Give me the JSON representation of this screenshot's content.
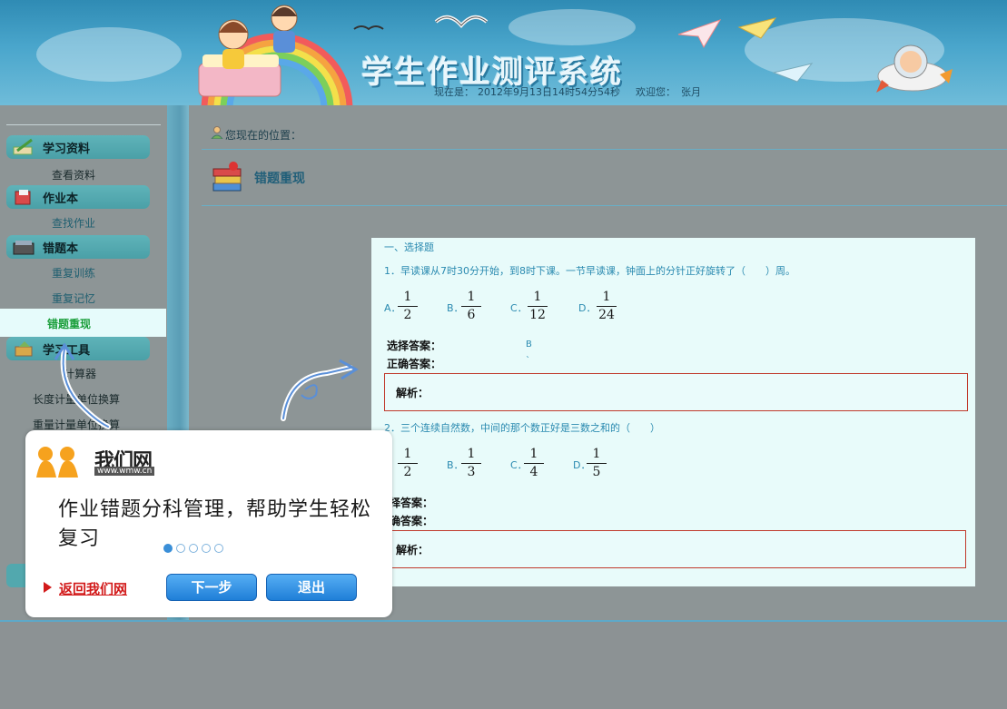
{
  "header": {
    "title": "学生作业测评系统",
    "status_label": "现在是：",
    "datetime": "2012年9月13日14时54分54秒",
    "welcome_label": "欢迎您：",
    "user": "张月"
  },
  "sidebar": {
    "categories": [
      {
        "label": "学习资料",
        "items": [
          "查看资料"
        ]
      },
      {
        "label": "作业本",
        "items": [
          "查找作业"
        ]
      },
      {
        "label": "错题本",
        "items": [
          "重复训练",
          "重复记忆",
          "错题重现"
        ]
      },
      {
        "label": "学习工具",
        "items": [
          "计算器",
          "长度计量单位换算",
          "重量计量单位换算"
        ]
      }
    ],
    "active_item": "错题重现"
  },
  "main": {
    "breadcrumb": "您现在的位置：",
    "heading": "错题重现"
  },
  "questions": {
    "section_title": "一、选择题",
    "q1": {
      "text": "1．早读课从7时30分开始，到8时下课。一节早读课，钟面上的分针正好旋转了（　　）周。",
      "options": [
        {
          "letter": "A．",
          "num": "1",
          "den": "2"
        },
        {
          "letter": "B．",
          "num": "1",
          "den": "6"
        },
        {
          "letter": "C．",
          "num": "1",
          "den": "12"
        },
        {
          "letter": "D．",
          "num": "1",
          "den": "24"
        }
      ],
      "selected_label": "选择答案：",
      "selected_value": "B",
      "correct_label": "正确答案：",
      "correct_value": "`",
      "analysis_label": "解析："
    },
    "q2": {
      "text": "2．三个连续自然数，中间的那个数正好是三数之和的（　　）",
      "options": [
        {
          "letter": "．",
          "num": "1",
          "den": "2"
        },
        {
          "letter": "B．",
          "num": "1",
          "den": "3"
        },
        {
          "letter": "C．",
          "num": "1",
          "den": "4"
        },
        {
          "letter": "D．",
          "num": "1",
          "den": "5"
        }
      ],
      "selected_label": "择答案：",
      "correct_label": "确答案：",
      "analysis_label": "解析："
    }
  },
  "guide": {
    "brand_name": "我们网",
    "brand_url": "www.wmw.cn",
    "message": "作业错题分科管理，帮助学生轻松复习",
    "step_current": 1,
    "step_total": 5,
    "back_link": "返回我们网",
    "next_button": "下一步",
    "exit_button": "退出"
  },
  "colors": {
    "header_blue": "#3d9cc4",
    "sidebar_tab": "#52a8ae",
    "active_text": "#1a9e3a",
    "panel_bg": "#e8fbfa",
    "analysis_border": "#c0392b",
    "button_blue": "#2a8be0"
  }
}
